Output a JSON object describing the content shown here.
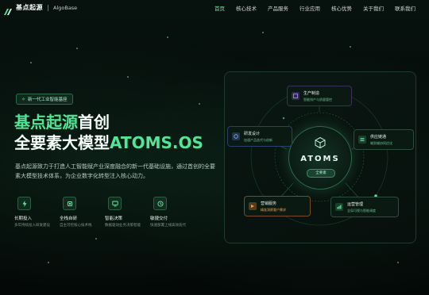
{
  "nav": {
    "brand_cn": "基点起源",
    "brand_en": "AlgoBase",
    "items": [
      {
        "label": "首页",
        "active": true
      },
      {
        "label": "核心技术",
        "active": false
      },
      {
        "label": "产品服务",
        "active": false
      },
      {
        "label": "行业应用",
        "active": false
      },
      {
        "label": "核心优势",
        "active": false
      },
      {
        "label": "关于我们",
        "active": false
      },
      {
        "label": "联系我们",
        "active": false
      }
    ]
  },
  "hero": {
    "badge": "新一代工业智能基座",
    "title_line1_green": "基点起源",
    "title_line1_white": "首创",
    "title_line2_white": "全要素大模型",
    "title_line2_green": "ATOMS.OS",
    "description": "基点起源致力于打造人工智能赋产业深度融合的新一代基础设施，通过首创的全要素大模型技术体系，为企业数字化转型注入核心动力。"
  },
  "features": [
    {
      "icon": "lightning-icon",
      "title": "长期投入",
      "sub": "多年持续投入研发建设"
    },
    {
      "icon": "chip-icon",
      "title": "全栈自研",
      "sub": "自主可控核心技术栈"
    },
    {
      "icon": "monitor-icon",
      "title": "智能决策",
      "sub": "数据驱动业务决策智能"
    },
    {
      "icon": "clock-icon",
      "title": "敏捷交付",
      "sub": "快速部署上线高效迭代"
    }
  ],
  "diagram": {
    "core_title": "ATOMS",
    "core_pill": "全要素",
    "nodes": [
      {
        "id": "top",
        "icon": "box-icon",
        "title": "生产制造",
        "sub": "智能排产与质量管控",
        "color": "#9a6cf0"
      },
      {
        "id": "left",
        "icon": "design-icon",
        "title": "研发设计",
        "sub": "加速产品迭代与创新",
        "color": "#5d8cf0"
      },
      {
        "id": "right",
        "icon": "supply-icon",
        "title": "供应链通",
        "sub": "端到端协同优化",
        "color": "#4fc88c"
      },
      {
        "id": "bottom-left",
        "icon": "marketing-icon",
        "title": "营销服务",
        "sub": "精准洞察客户需求",
        "color": "#f0904a"
      },
      {
        "id": "bottom-right",
        "icon": "operations-icon",
        "title": "运营管理",
        "sub": "全局可视与智能调度",
        "color": "#4fc88c"
      }
    ]
  },
  "colors": {
    "accent": "#52e596",
    "background": "#050b09"
  }
}
